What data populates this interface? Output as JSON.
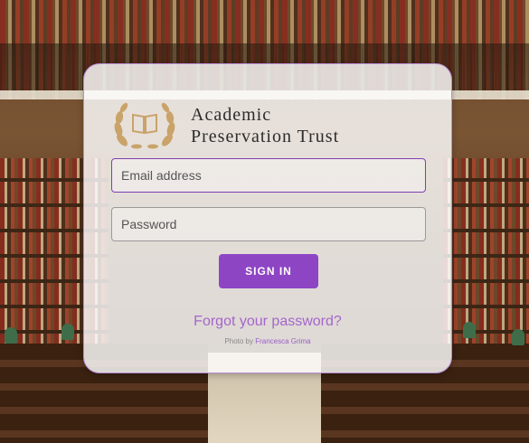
{
  "brand": {
    "line1": "Academic",
    "line2": "Preservation Trust",
    "logo_icon": "laurel-book-icon"
  },
  "login": {
    "email_placeholder": "Email address",
    "email_value": "",
    "password_placeholder": "Password",
    "password_value": "",
    "signin_label": "SIGN IN",
    "forgot_label": "Forgot your password?"
  },
  "credit": {
    "prefix": "Photo by",
    "author": "Francesca Grima"
  },
  "colors": {
    "accent": "#8e45c4",
    "link": "#a466cc",
    "logo_gold": "#c9a36a"
  }
}
